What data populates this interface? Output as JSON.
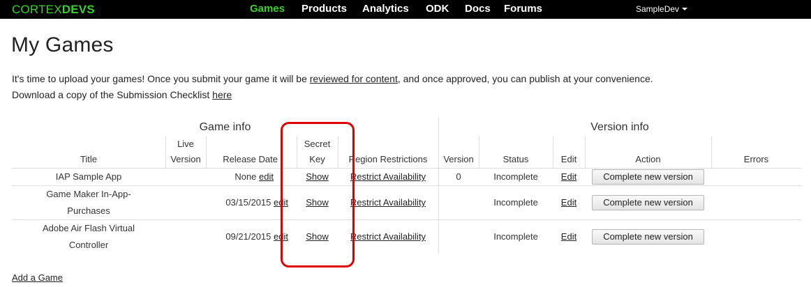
{
  "nav": {
    "logo_part1": "CORTEX",
    "logo_part2": "DEVS",
    "items": [
      "Games",
      "Products",
      "Analytics",
      "ODK",
      "Docs",
      "Forums"
    ],
    "active": "Games",
    "user": "SampleDev"
  },
  "page": {
    "title": "My Games",
    "intro_text_before": "It's time to upload your games! Once you submit your game it will be ",
    "intro_link": "reviewed for content",
    "intro_text_after": ", and once approved, you can publish at your convenience.",
    "checklist_text": "Download a copy of the Submission Checklist ",
    "checklist_link": "here",
    "add_game": "Add a Game"
  },
  "table": {
    "group_game_info": "Game info",
    "group_version_info": "Version info",
    "headers": {
      "title": "Title",
      "live_version_1": "Live",
      "live_version_2": "Version",
      "release_date": "Release Date",
      "secret_key_1": "Secret",
      "secret_key_2": "Key",
      "region": "Region Restrictions",
      "version": "Version",
      "status": "Status",
      "edit": "Edit",
      "action": "Action",
      "errors": "Errors"
    },
    "rows": [
      {
        "title_line1": "IAP Sample App",
        "title_line2": "",
        "release_date": "None",
        "date_edit": "edit",
        "secret_key": "Show",
        "region": "Restrict Availability",
        "version": "0",
        "status": "Incomplete",
        "edit": "Edit",
        "action": "Complete new version"
      },
      {
        "title_line1": "Game Maker In-App-",
        "title_line2": "Purchases",
        "release_date": "03/15/2015",
        "date_edit": "edit",
        "secret_key": "Show",
        "region": "Restrict Availability",
        "version": "",
        "status": "Incomplete",
        "edit": "Edit",
        "action": "Complete new version"
      },
      {
        "title_line1": "Adobe Air Flash Virtual",
        "title_line2": "Controller",
        "release_date": "09/21/2015",
        "date_edit": "edit",
        "secret_key": "Show",
        "region": "Restrict Availability",
        "version": "",
        "status": "Incomplete",
        "edit": "Edit",
        "action": "Complete new version"
      }
    ]
  },
  "annotation": {
    "highlight_color": "#e00000"
  }
}
